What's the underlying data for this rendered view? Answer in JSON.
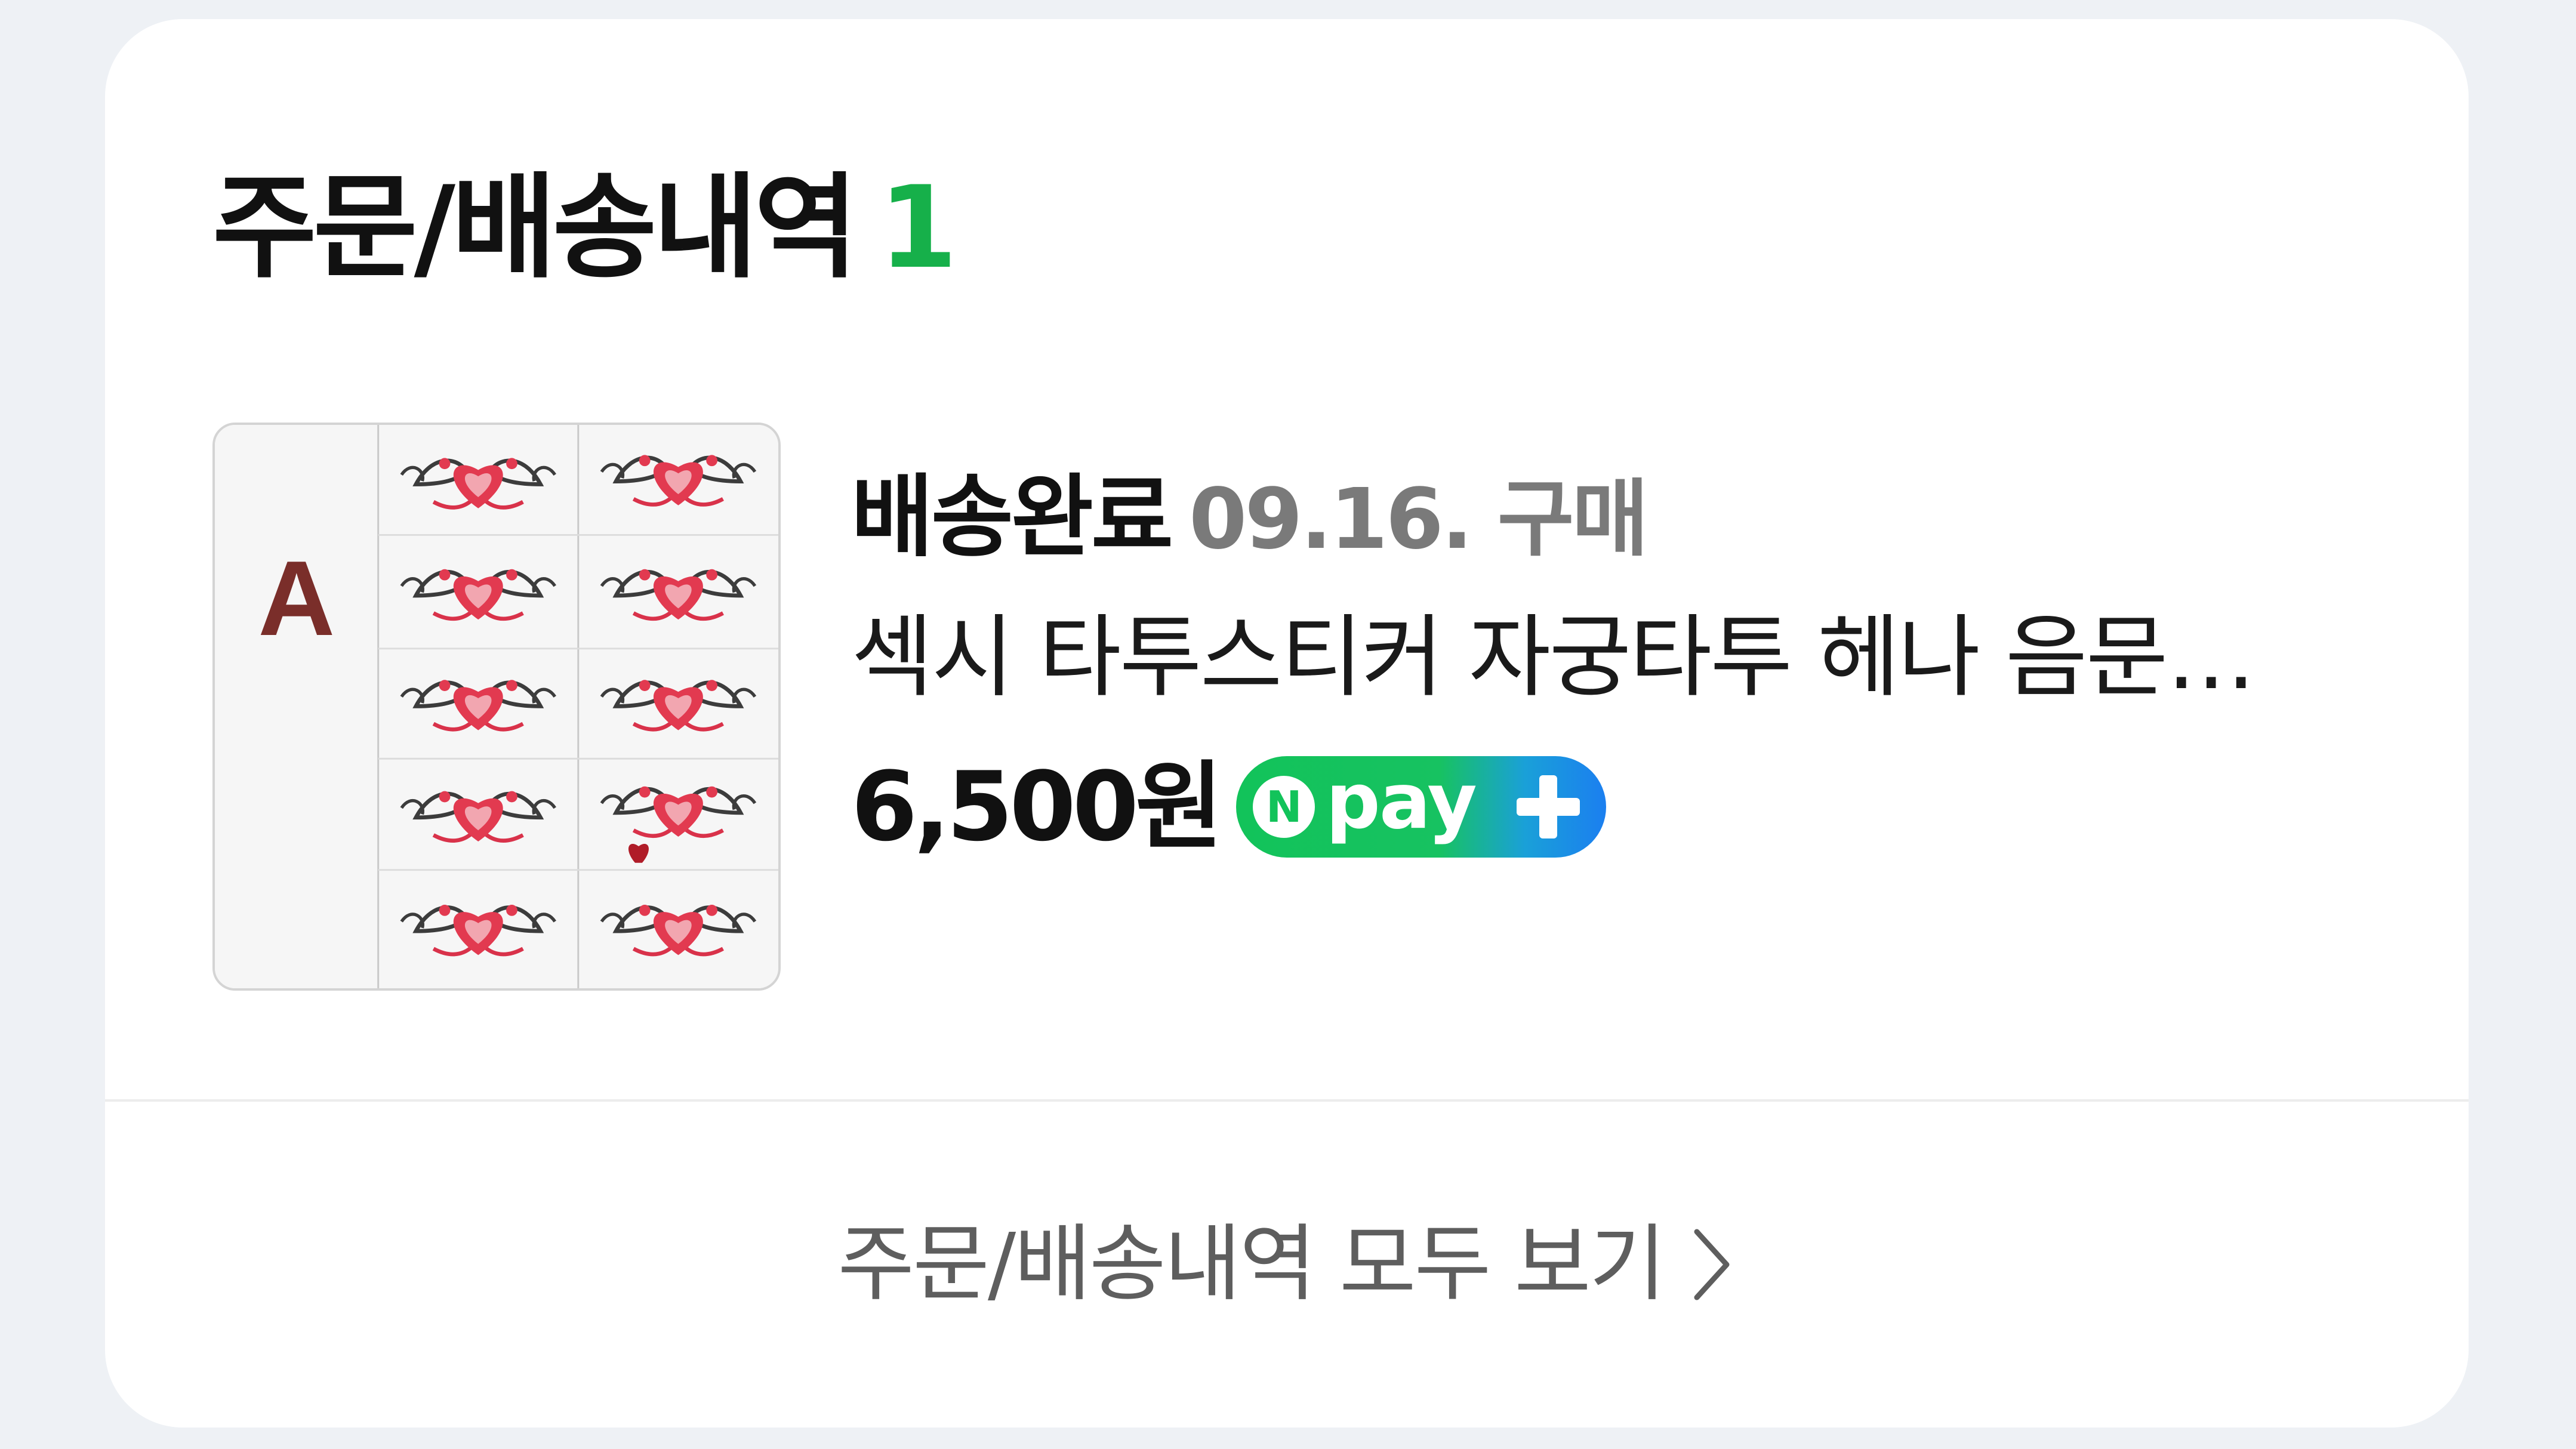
{
  "section": {
    "title": "주문/배송내역",
    "count": "1"
  },
  "order": {
    "thumbnail": {
      "letter": "A",
      "description": "heart tattoo stickers"
    },
    "status": "배송완료",
    "date": "09.16. 구매",
    "product_name": "섹시 타투스티커 자궁타투 헤나 음문…",
    "price": "6,500원",
    "payment_badge": {
      "n_label": "N",
      "pay_label": "pay"
    }
  },
  "footer": {
    "view_all_label": "주문/배송내역 모두 보기",
    "chevron_icon": "chevron-right-icon"
  },
  "colors": {
    "accent_green": "#16b04a",
    "npay_green": "#12c35a",
    "npay_blue": "#1b7ff0",
    "card_bg": "#ffffff",
    "page_bg": "#eef1f5"
  }
}
